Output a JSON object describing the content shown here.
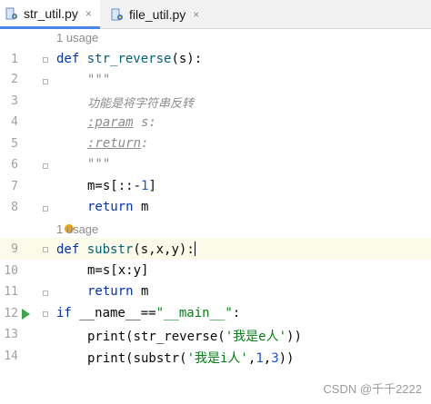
{
  "tabs": [
    {
      "label": "str_util.py",
      "close": "×"
    },
    {
      "label": "file_util.py",
      "close": "×"
    }
  ],
  "hints": [
    "1 usage",
    "1 usage"
  ],
  "line_numbers": [
    "1",
    "2",
    "3",
    "4",
    "5",
    "6",
    "7",
    "8",
    "9",
    "10",
    "11",
    "12",
    "13",
    "14"
  ],
  "code": {
    "l1": {
      "kw": "def",
      "fn": "str_reverse",
      "rest": "(s):"
    },
    "l2": "\"\"\"",
    "l3": "功能是将字符串反转",
    "l4": {
      "tag": ":param",
      "rest": " s:"
    },
    "l5": {
      "tag": ":return",
      "rest": ":"
    },
    "l6": "\"\"\"",
    "l7": {
      "a": "m=s[::-",
      "num": "1",
      "b": "]"
    },
    "l8": {
      "kw": "return",
      "rest": " m"
    },
    "l9": {
      "kw": "def",
      "fn": "substr",
      "rest": "(s,x,y):"
    },
    "l10": "m=s[x:y]",
    "l11": {
      "kw": "return",
      "rest": " m"
    },
    "l12": {
      "kw": "if",
      "mid": " __name__==",
      "str": "\"__main__\"",
      "end": ":"
    },
    "l13": {
      "a": "print(str_reverse(",
      "str": "'我是e人'",
      "b": "))"
    },
    "l14": {
      "a": "print(substr(",
      "str": "'我是i人'",
      "mid": ",",
      "n1": "1",
      "c": ",",
      "n2": "3",
      "b": "))"
    }
  },
  "watermark": "CSDN @千千2222",
  "colors": {
    "keyword": "#0033b3",
    "function": "#00627a",
    "string": "#067d17",
    "number": "#1750eb",
    "comment": "#8c8c8c"
  },
  "icons": {
    "python_file": "python-file-icon",
    "run": "run-icon",
    "intention": "lightbulb-icon"
  }
}
